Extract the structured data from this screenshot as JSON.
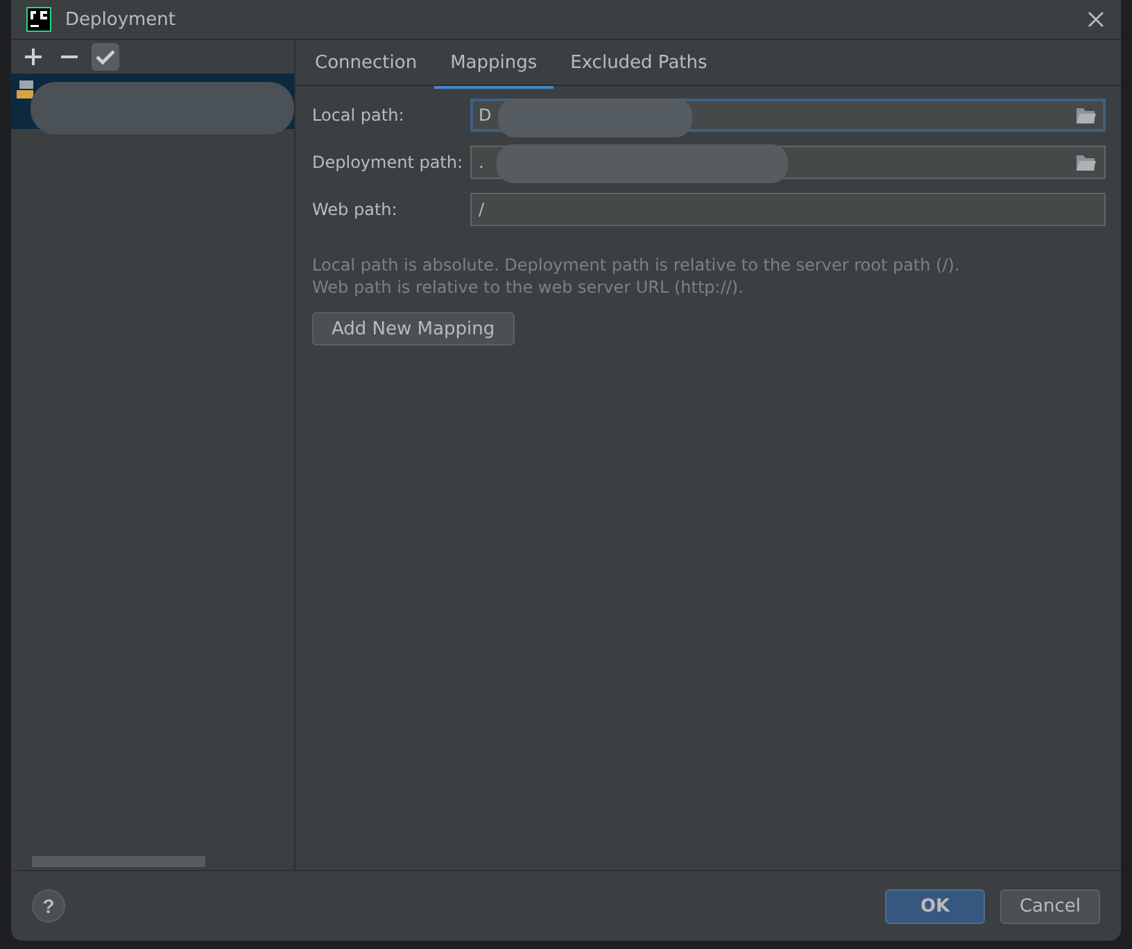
{
  "window": {
    "title": "Deployment"
  },
  "toolbar": {
    "buttons": [
      {
        "kind": "add",
        "disabled": false
      },
      {
        "kind": "remove",
        "disabled": false
      },
      {
        "kind": "check",
        "disabled": false
      }
    ]
  },
  "servers": [
    {
      "selected": true,
      "redacted": true
    }
  ],
  "tabs": [
    {
      "label": "Connection",
      "selected": false
    },
    {
      "label": "Mappings",
      "selected": true
    },
    {
      "label": "Excluded Paths",
      "selected": false
    }
  ],
  "fields": [
    {
      "label": "Local path:",
      "value": "D",
      "browse": true,
      "focused": true,
      "redacted": true
    },
    {
      "label": "Deployment path:",
      "value": ".",
      "browse": true,
      "focused": false,
      "redacted": true
    },
    {
      "label": "Web path:",
      "value": "/",
      "browse": false,
      "focused": false,
      "redacted": false
    }
  ],
  "hint": [
    "Local path is absolute. Deployment path is relative to the server root path (/).",
    "Web path is relative to the web server URL (http://)."
  ],
  "add_button": "Add New Mapping",
  "footer": {
    "help": "?",
    "ok": "OK",
    "cancel": "Cancel"
  }
}
